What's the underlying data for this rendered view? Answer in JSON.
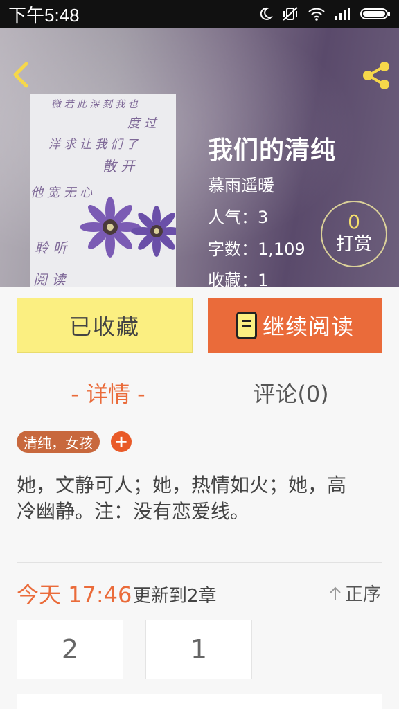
{
  "status_bar": {
    "time": "下午5:48"
  },
  "header": {
    "cover_lines": [
      "微 若 此 深 刻 我 也",
      "度 过",
      "洋 求 让 我 们 了",
      "散 开",
      "他 宽 无 心",
      "聆 听",
      "阅 读"
    ],
    "title": "我们的清纯",
    "author": "慕雨遥暖",
    "popularity": "人气：3",
    "word_count": "字数：1,109",
    "favorites": "收藏：1",
    "reward_count": "0",
    "reward_label": "打赏"
  },
  "actions": {
    "favorited_label": "已收藏",
    "continue_label": "继续阅读"
  },
  "tabs": {
    "detail": "- 详情 -",
    "comments": "评论(0)"
  },
  "tags": {
    "label": "清纯，女孩",
    "add": "+"
  },
  "summary": "她，文静可人；她，热情如火；她，高冷幽静。注：没有恋爱线。",
  "update": {
    "time": "今天 17:46",
    "chapter": "更新到2章",
    "order": "正序"
  },
  "chapters": [
    "2",
    "1"
  ],
  "colors": {
    "accent": "#ea6b3a",
    "favorite_bg": "#fbef81",
    "icon_yellow": "#f6d84a"
  }
}
